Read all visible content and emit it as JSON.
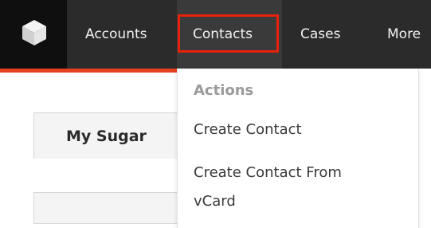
{
  "nav": {
    "logo_icon": "sugar-cube-icon",
    "tabs": [
      {
        "label": "Accounts"
      },
      {
        "label": "Contacts",
        "active": true
      },
      {
        "label": "Cases"
      },
      {
        "label": "More"
      }
    ]
  },
  "page": {
    "my_sugar_tab": "My Sugar"
  },
  "dropdown": {
    "section_header": "Actions",
    "items": [
      {
        "label": "Create Contact"
      },
      {
        "label": "Create Contact From vCard"
      }
    ]
  },
  "colors": {
    "nav_bg": "#2b2b2b",
    "logo_bg": "#0f0f0f",
    "highlight_border": "#e8210a",
    "accent_line": "#e5401f"
  }
}
